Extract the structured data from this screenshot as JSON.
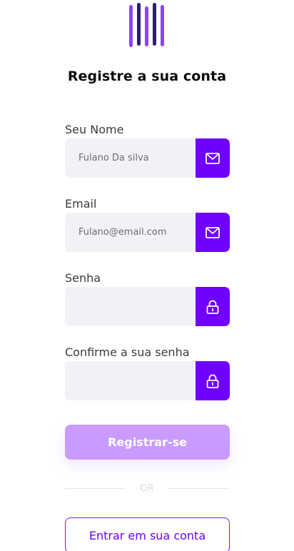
{
  "header": {
    "logo": "brand-logo-bars",
    "title": "Registre a sua conta"
  },
  "form": {
    "name": {
      "label": "Seu Nome",
      "value": "",
      "placeholder": "Fulano Da silva",
      "icon": "mail-icon"
    },
    "email": {
      "label": "Email",
      "value": "",
      "placeholder": "Fulano@email.com",
      "icon": "mail-icon"
    },
    "password": {
      "label": "Senha",
      "value": "",
      "placeholder": "",
      "icon": "lock-icon"
    },
    "confirm": {
      "label": "Confirme a sua senha",
      "value": "",
      "placeholder": "",
      "icon": "lock-icon"
    },
    "submit_label": "Registrar-se",
    "or_label": "OR",
    "login_label": "Entrar em sua conta"
  },
  "colors": {
    "accent": "#7000ff",
    "submit_bg": "#c99bff",
    "input_bg": "#f1f2f6"
  }
}
